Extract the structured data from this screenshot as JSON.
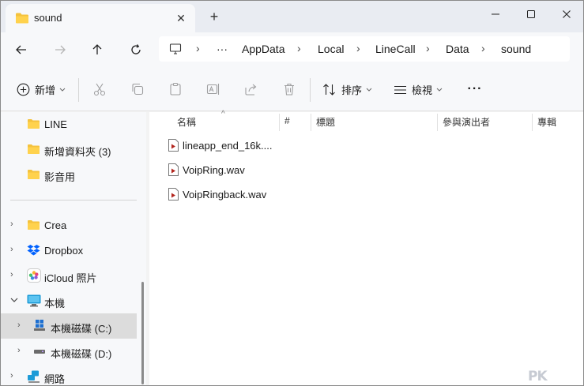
{
  "tab": {
    "title": "sound",
    "close_glyph": "✕",
    "new_tab_glyph": "+"
  },
  "window_controls": {
    "minimize": "—",
    "maximize": "☐",
    "close": "✕"
  },
  "breadcrumb": {
    "overflow": "···",
    "items": [
      "AppData",
      "Local",
      "LineCall",
      "Data",
      "sound"
    ]
  },
  "command_bar": {
    "new_label": "新增",
    "sort_label": "排序",
    "view_label": "檢視",
    "more_glyph": "···"
  },
  "sidebar": {
    "quick": [
      "LINE",
      "新增資料夾 (3)",
      "影音用"
    ],
    "tree": [
      {
        "label": "Crea",
        "icon": "folder-icon",
        "expanded": false
      },
      {
        "label": "Dropbox",
        "icon": "dropbox-icon",
        "expanded": false
      },
      {
        "label": "iCloud 照片",
        "icon": "icloud-photos-icon",
        "expanded": false
      },
      {
        "label": "本機",
        "icon": "pc-icon",
        "expanded": true
      },
      {
        "label": "本機磁碟 (C:)",
        "icon": "windows-drive-icon",
        "expanded": false,
        "selected": true
      },
      {
        "label": "本機磁碟 (D:)",
        "icon": "drive-icon",
        "expanded": false
      },
      {
        "label": "網路",
        "icon": "network-icon",
        "expanded": false
      }
    ]
  },
  "columns": [
    "名稱",
    "#",
    "標題",
    "參與演出者",
    "專輯"
  ],
  "files": [
    "lineapp_end_16k....",
    "VoipRing.wav",
    "VoipRingback.wav"
  ],
  "watermark": "PK",
  "colors": {
    "folder": "#f4c23d",
    "accent": "#0067c0",
    "selected": "#dcdcdc"
  }
}
